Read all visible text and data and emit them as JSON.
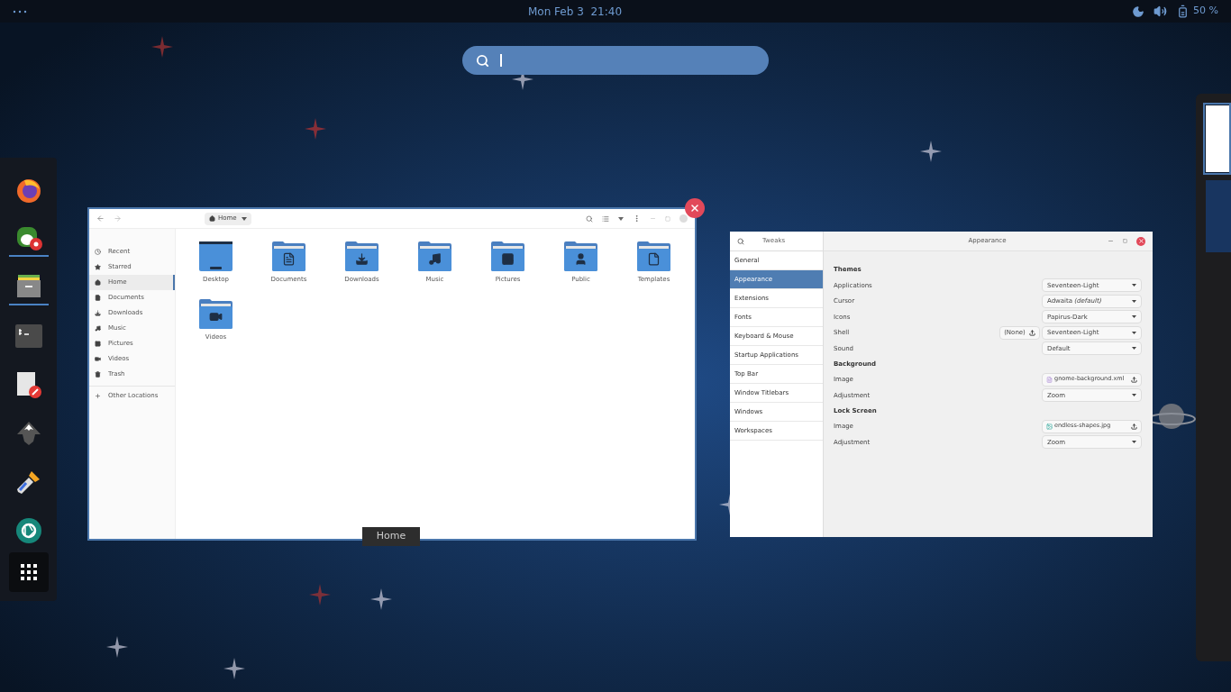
{
  "top_bar": {
    "clock": "Mon Feb 3  21:40",
    "battery": "50 %"
  },
  "dock": [
    {
      "kind": "browser",
      "running": false
    },
    {
      "kind": "photos",
      "running": true
    },
    {
      "kind": "files",
      "running": true
    },
    {
      "kind": "terminal",
      "running": false
    },
    {
      "kind": "editor",
      "running": false
    },
    {
      "kind": "vector",
      "running": false
    },
    {
      "kind": "picker",
      "running": false
    },
    {
      "kind": "camera",
      "running": false
    },
    {
      "kind": "grid",
      "running": false
    }
  ],
  "files_window": {
    "selected": true,
    "location": "Home",
    "caption": "Home",
    "sidebar": [
      {
        "label": "Recent",
        "kind": "recent",
        "selected": false
      },
      {
        "label": "Starred",
        "kind": "star",
        "selected": false
      },
      {
        "label": "Home",
        "kind": "home",
        "selected": true
      },
      {
        "label": "Documents",
        "kind": "doc",
        "selected": false
      },
      {
        "label": "Downloads",
        "kind": "download",
        "selected": false
      },
      {
        "label": "Music",
        "kind": "music",
        "selected": false
      },
      {
        "label": "Pictures",
        "kind": "image",
        "selected": false
      },
      {
        "label": "Videos",
        "kind": "video",
        "selected": false
      },
      {
        "label": "Trash",
        "kind": "trash",
        "selected": false
      }
    ],
    "other_locations": "Other Locations",
    "folders": [
      {
        "name": "Desktop",
        "kind": "desktop"
      },
      {
        "name": "Documents",
        "kind": "doc"
      },
      {
        "name": "Downloads",
        "kind": "download"
      },
      {
        "name": "Music",
        "kind": "music"
      },
      {
        "name": "Pictures",
        "kind": "image"
      },
      {
        "name": "Public",
        "kind": "user"
      },
      {
        "name": "Templates",
        "kind": "template"
      },
      {
        "name": "Videos",
        "kind": "video"
      }
    ]
  },
  "tweaks_window": {
    "title": "Tweaks",
    "page_title": "Appearance",
    "sidebar": [
      {
        "label": "General",
        "selected": false
      },
      {
        "label": "Appearance",
        "selected": true
      },
      {
        "label": "Extensions",
        "selected": false
      },
      {
        "label": "Fonts",
        "selected": false
      },
      {
        "label": "Keyboard & Mouse",
        "selected": false
      },
      {
        "label": "Startup Applications",
        "selected": false
      },
      {
        "label": "Top Bar",
        "selected": false
      },
      {
        "label": "Window Titlebars",
        "selected": false
      },
      {
        "label": "Windows",
        "selected": false
      },
      {
        "label": "Workspaces",
        "selected": false
      }
    ],
    "sections": [
      {
        "heading": "Themes",
        "rows": [
          {
            "label": "Applications",
            "kind": "combo",
            "value": "Seventeen-Light"
          },
          {
            "label": "Cursor",
            "kind": "combo",
            "value": "Adwaita *(default)*"
          },
          {
            "label": "Icons",
            "kind": "combo",
            "value": "Papirus-Dark"
          },
          {
            "label": "Shell",
            "kind": "combo",
            "value": "Seventeen-Light",
            "extra": "(None)"
          },
          {
            "label": "Sound",
            "kind": "combo",
            "value": "Default"
          }
        ]
      },
      {
        "heading": "Background",
        "rows": [
          {
            "label": "Image",
            "kind": "file",
            "value": "gnome-background.xml"
          },
          {
            "label": "Adjustment",
            "kind": "combo",
            "value": "Zoom"
          }
        ]
      },
      {
        "heading": "Lock Screen",
        "rows": [
          {
            "label": "Image",
            "kind": "image",
            "value": "endless-shapes.jpg"
          },
          {
            "label": "Adjustment",
            "kind": "combo",
            "value": "Zoom"
          }
        ]
      }
    ]
  },
  "workspaces": [
    {
      "selected": true,
      "kind": "windows"
    },
    {
      "selected": false,
      "kind": "empty"
    }
  ]
}
